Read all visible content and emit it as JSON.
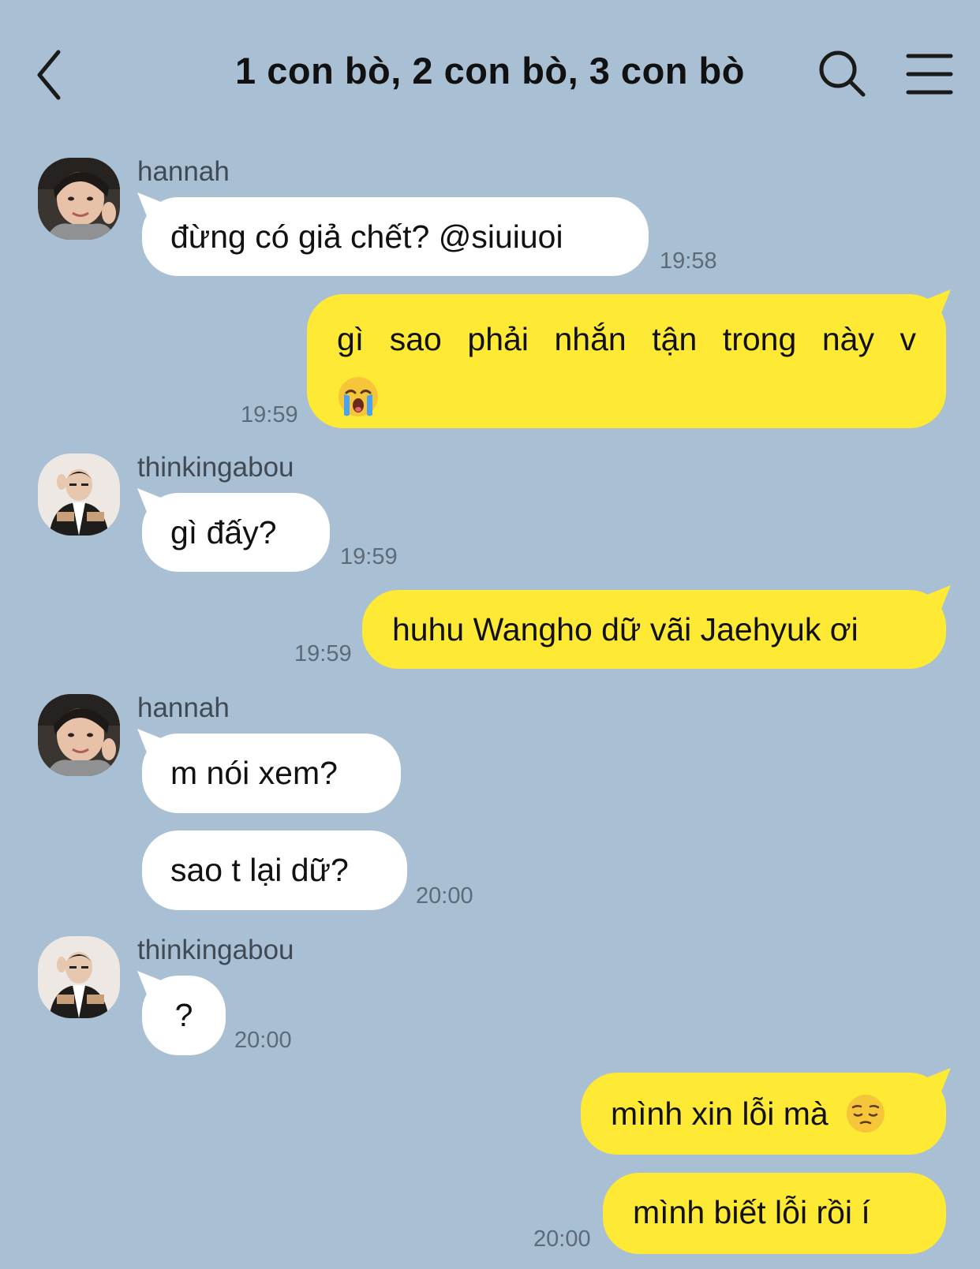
{
  "header": {
    "back_icon": "chevron-left-icon",
    "title": "1 con bò, 2 con bò, 3 con bò",
    "search_icon": "search-icon",
    "menu_icon": "hamburger-menu-icon"
  },
  "colors": {
    "background": "#a9bfd3",
    "incoming_bubble": "#ffffff",
    "outgoing_bubble": "#fee935"
  },
  "messages": [
    {
      "sender": "hannah",
      "text": "đừng có giả chết? @siuiuoi",
      "time": "19:58"
    },
    {
      "sender": "me",
      "text": "gì sao phải nhắn tận trong này v",
      "emoji": "loudly-crying-face",
      "time": "19:59"
    },
    {
      "sender": "thinkingabou",
      "text": "gì đấy?",
      "time": "19:59"
    },
    {
      "sender": "me",
      "text": "huhu Wangho dữ vãi Jaehyuk ơi",
      "time": "19:59"
    },
    {
      "sender": "hannah",
      "text": "m nói xem?",
      "time": ""
    },
    {
      "sender": "hannah",
      "text": "sao t lại dữ?",
      "time": "20:00"
    },
    {
      "sender": "thinkingabou",
      "text": "?",
      "time": "20:00"
    },
    {
      "sender": "me",
      "text": "mình xin lỗi mà",
      "emoji": "pensive-face",
      "time": ""
    },
    {
      "sender": "me",
      "text": "mình biết lỗi rồi í",
      "time": "20:00"
    }
  ]
}
